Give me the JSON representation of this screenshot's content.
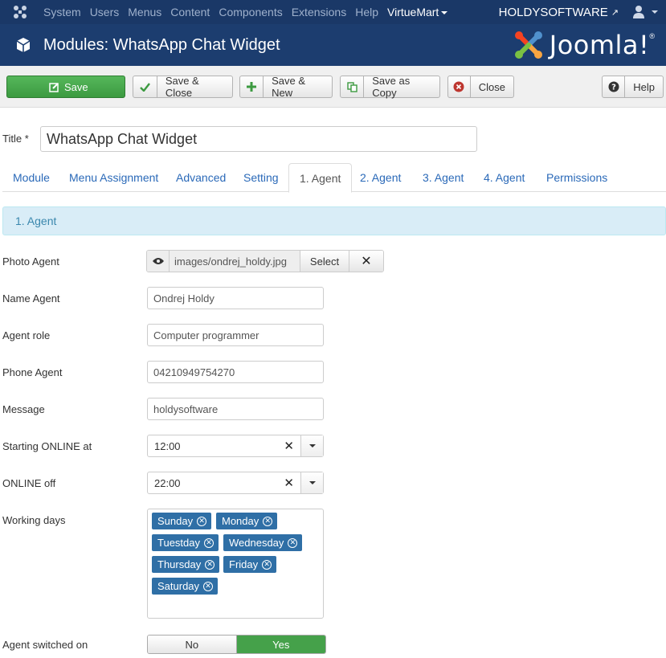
{
  "navbar": {
    "menu": [
      "System",
      "Users",
      "Menus",
      "Content",
      "Components",
      "Extensions",
      "Help"
    ],
    "virtuemart": "VirtueMart",
    "site_name": "HOLDYSOFTWARE"
  },
  "header": {
    "title": "Modules: WhatsApp Chat Widget",
    "brand": "Joomla!"
  },
  "toolbar": {
    "save": "Save",
    "save_close": "Save & Close",
    "save_new": "Save & New",
    "save_copy": "Save as Copy",
    "close": "Close",
    "help": "Help"
  },
  "form": {
    "title_label": "Title *",
    "title_value": "WhatsApp Chat Widget"
  },
  "tabs": [
    "Module",
    "Menu Assignment",
    "Advanced",
    "Setting",
    "1. Agent",
    "2. Agent",
    "3. Agent",
    "4. Agent",
    "Permissions"
  ],
  "active_tab": "1. Agent",
  "section_title": "1. Agent",
  "agent": {
    "photo_label": "Photo Agent",
    "photo_path": "images/ondrej_holdy.jpg",
    "select_label": "Select",
    "name_label": "Name Agent",
    "name_value": "Ondrej Holdy",
    "role_label": "Agent role",
    "role_value": "Computer programmer",
    "phone_label": "Phone Agent",
    "phone_value": "04210949754270",
    "message_label": "Message",
    "message_value": "holdysoftware",
    "start_label": "Starting ONLINE at",
    "start_value": "12:00",
    "off_label": "ONLINE off",
    "off_value": "22:00",
    "days_label": "Working days",
    "days": [
      "Sunday",
      "Monday",
      "Tuestday",
      "Wednesday",
      "Thursday",
      "Friday",
      "Saturday"
    ],
    "switch_label": "Agent switched on",
    "switch_no": "No",
    "switch_yes": "Yes",
    "switch_value": "Yes"
  },
  "colors": {
    "navbar": "#1a3867",
    "header": "#1c3d6f",
    "save_green": "#46a74b",
    "chip_blue": "#2f6fa6",
    "link_blue": "#2a69b8"
  }
}
